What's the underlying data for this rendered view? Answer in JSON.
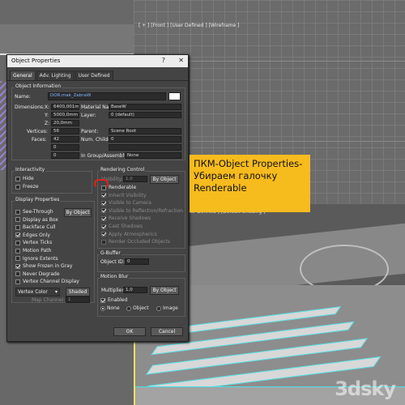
{
  "viewports": {
    "front_label": "[ + ] [Front ] [User Defined ] [Wireframe ]",
    "persp_label": "ser Defined ] [Default Shading ]",
    "bottom_label": "[ + ] [Perspective ] [User Defined ] [Default Shading ]"
  },
  "dialog": {
    "title": "Object Properties",
    "help": "?",
    "close": "✕",
    "tabs": [
      "General",
      "Adv. Lighting",
      "User Defined"
    ],
    "object_info": {
      "heading": "Object Information",
      "name_label": "Name:",
      "name_value": "DOR.mak_ZebraW",
      "dimensions_label": "Dimensions:",
      "x_label": "X:",
      "x_value": "6400,001m",
      "y_label": "Y:",
      "y_value": "5000,0mm",
      "z_label": "Z:",
      "z_value": "20,0mm",
      "vertices_label": "Vertices:",
      "vertices_value": "56",
      "faces_label": "Faces:",
      "faces_value": "42",
      "blank1": "0",
      "blank2": "0",
      "material_label": "Material Name:",
      "material_value": "BaseW",
      "layer_label": "Layer:",
      "layer_value": "0 (default)",
      "parent_label": "Parent:",
      "parent_value": "Scene Root",
      "children_label": "Num. Children:",
      "children_value": "0",
      "group_label": "In Group/Assembly:",
      "group_value": "None"
    },
    "interactivity": {
      "heading": "Interactivity",
      "hide": "Hide",
      "freeze": "Freeze"
    },
    "display_properties": {
      "heading": "Display Properties",
      "by_object": "By Object",
      "items": [
        {
          "label": "See-Through",
          "checked": false
        },
        {
          "label": "Display as Box",
          "checked": false
        },
        {
          "label": "Backface Cull",
          "checked": false
        },
        {
          "label": "Edges Only",
          "checked": true
        },
        {
          "label": "Vertex Ticks",
          "checked": false
        },
        {
          "label": "Motion Path",
          "checked": false
        },
        {
          "label": "Ignore Extents",
          "checked": false
        },
        {
          "label": "Show Frozen in Gray",
          "checked": true
        },
        {
          "label": "Never Degrade",
          "checked": false
        },
        {
          "label": "Vertex Channel Display",
          "checked": false
        }
      ],
      "vertex_color": "Vertex Color",
      "shaded": "Shaded",
      "map_channel_label": "Map Channel:",
      "map_channel_value": "1"
    },
    "rendering_control": {
      "heading": "Rendering Control",
      "visibility_label": "Visibility:",
      "visibility_value": "1,0",
      "by_object": "By Object",
      "items": [
        {
          "label": "Renderable",
          "checked": false,
          "disabled": false
        },
        {
          "label": "Inherit Visibility",
          "checked": true,
          "disabled": true
        },
        {
          "label": "Visible to Camera",
          "checked": true,
          "disabled": true
        },
        {
          "label": "Visible to Reflection/Refraction",
          "checked": true,
          "disabled": true
        },
        {
          "label": "Receive Shadows",
          "checked": true,
          "disabled": true
        },
        {
          "label": "Cast Shadows",
          "checked": true,
          "disabled": true
        },
        {
          "label": "Apply Atmospherics",
          "checked": true,
          "disabled": true
        },
        {
          "label": "Render Occluded Objects",
          "checked": false,
          "disabled": true
        }
      ]
    },
    "gbuffer": {
      "heading": "G-Buffer",
      "object_id_label": "Object ID:",
      "object_id_value": "0"
    },
    "motion_blur": {
      "heading": "Motion Blur",
      "multiplier_label": "Multiplier:",
      "multiplier_value": "1,0",
      "by_object": "By Object",
      "enabled": "Enabled",
      "none": "None",
      "object": "Object",
      "image": "Image"
    },
    "ok": "OK",
    "cancel": "Cancel"
  },
  "callout": {
    "line1": "ПКМ-Object Properties-",
    "line2": "Убираем галочку",
    "line3": "Renderable",
    "color": "#f6bb1d"
  },
  "watermark": "3dsky"
}
